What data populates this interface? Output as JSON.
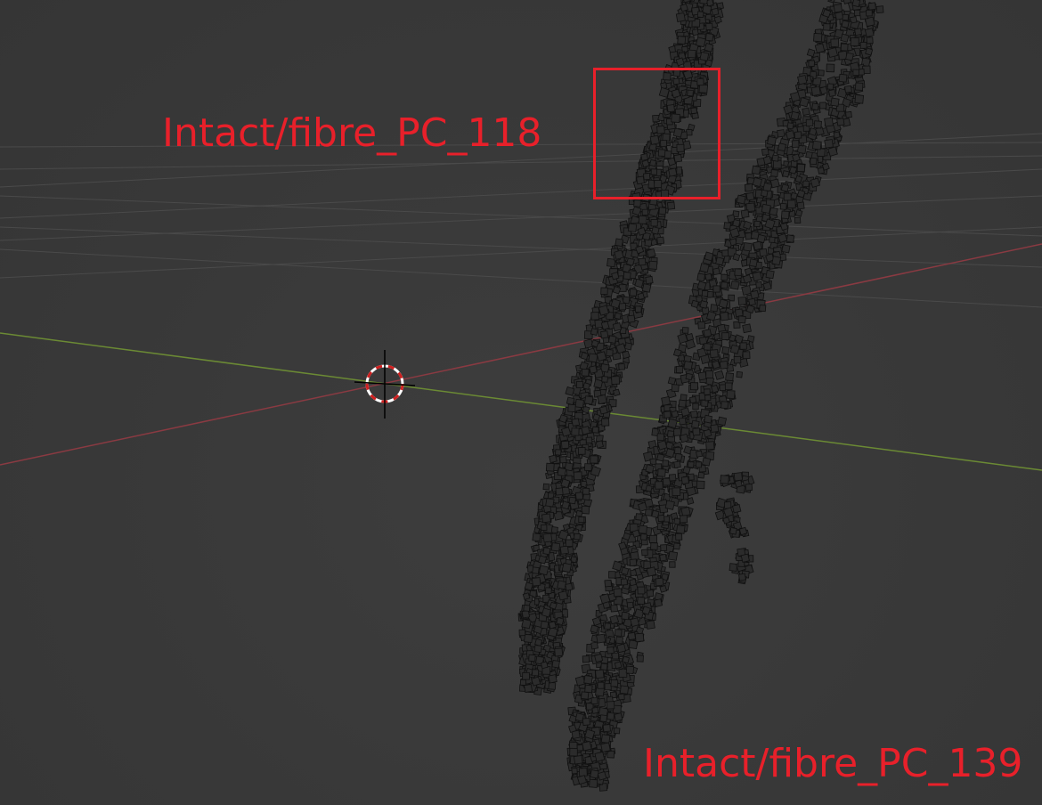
{
  "viewport": {
    "background_color": "#3a3a3a",
    "grid_color": "#4a4a4a",
    "x_axis_color": "#8a3a42",
    "y_axis_color": "#6b8a34",
    "point_fill_color": "#2b2b2b",
    "point_edge_color": "#101010"
  },
  "annotations": {
    "highlight_color": "#e8202a",
    "label_top": "Intact/fibre_PC_118",
    "label_bottom": "Intact/fibre_PC_139"
  },
  "objects": [
    {
      "name": "Intact/fibre_PC_118"
    },
    {
      "name": "Intact/fibre_PC_139"
    }
  ],
  "cursor_3d": {
    "icon": "3d-cursor-icon"
  }
}
